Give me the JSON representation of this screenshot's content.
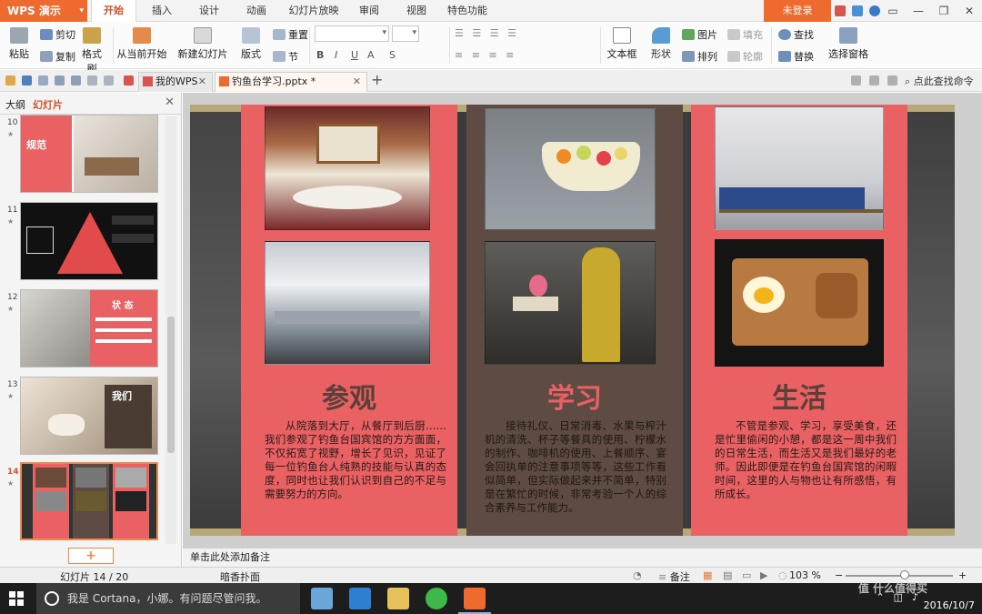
{
  "app": {
    "name": "WPS 演示",
    "login_label": "未登录"
  },
  "ribbon_tabs": [
    "开始",
    "插入",
    "设计",
    "动画",
    "幻灯片放映",
    "审阅",
    "视图",
    "特色功能"
  ],
  "ribbon": {
    "paste": "粘贴",
    "cut": "剪切",
    "copy": "复制",
    "format_painter": "格式刷",
    "from_current": "从当前开始",
    "new_slide": "新建幻灯片",
    "layout": "版式",
    "reset": "重置",
    "section": "节",
    "textbox": "文本框",
    "shape": "形状",
    "picture": "图片",
    "arrange": "排列",
    "fill": "填充",
    "outline": "轮廓",
    "find": "查找",
    "replace": "替换",
    "select_pane": "选择窗格"
  },
  "doc_tabs": [
    {
      "label": "我的WPS",
      "active": false
    },
    {
      "label": "钓鱼台学习.pptx *",
      "active": true
    }
  ],
  "search_command": "点此查找命令",
  "left_panel": {
    "tabs": [
      "大纲",
      "幻灯片"
    ],
    "thumbnails": [
      {
        "num": "10",
        "text": "规范"
      },
      {
        "num": "11",
        "text": ""
      },
      {
        "num": "12",
        "text": "状 态"
      },
      {
        "num": "13",
        "text": "我们"
      },
      {
        "num": "14",
        "text": ""
      }
    ]
  },
  "slide": {
    "panels": [
      {
        "title": "参观",
        "body": "从院落到大厅，从餐厅到后厨……我们参观了钓鱼台国宾馆的方方面面，不仅拓宽了视野，增长了见识，见证了每一位钓鱼台人纯熟的技能与认真的态度，同时也让我们认识到自己的不足与需要努力的方向。"
      },
      {
        "title": "学习",
        "body": "接待礼仪、日常消毒、水果与榨汁机的清洗、杯子等餐具的使用、柠檬水的制作、咖啡机的使用、上餐顺序、宴会回执单的注意事项等等，这些工作看似简单，但实际做起来并不简单，特别是在繁忙的时候，非常考验一个人的综合素养与工作能力。"
      },
      {
        "title": "生活",
        "body": "不管是参观、学习，享受美食，还是忙里偷闲的小憩，都是这一周中我们的日常生活，而生活又是我们最好的老师。因此即便是在钓鱼台国宾馆的闲暇时间，这里的人与物也让有所感悟，有所成长。"
      }
    ]
  },
  "notes_placeholder": "单击此处添加备注",
  "status": {
    "slide_counter": "幻灯片 14 / 20",
    "theme": "暗香扑面",
    "notes_label": "备注",
    "zoom": "103 %",
    "zoom_level": 0.55
  },
  "taskbar": {
    "cortana_placeholder": "我是 Cortana，小娜。有问题尽管问我。",
    "time": "2016/10/7"
  },
  "watermark": "值 什么值得买",
  "colors": {
    "accent": "#ee6a2e",
    "slide_pink": "#ea6163",
    "slide_brown": "#5e4b43"
  }
}
